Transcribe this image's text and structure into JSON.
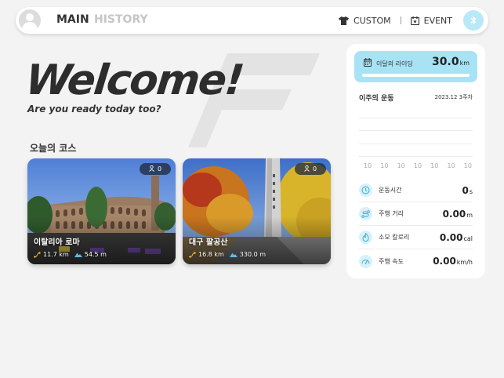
{
  "nav": {
    "main": "MAIN",
    "history": "HISTORY",
    "custom": "CUSTOM",
    "event": "EVENT"
  },
  "hero": {
    "title": "Welcome!",
    "subtitle": "Are you ready today too?"
  },
  "courses": {
    "heading": "오늘의 코스",
    "items": [
      {
        "name": "이탈리아 로마",
        "participants": "0",
        "distance": "11.7 km",
        "elevation": "54.5 m"
      },
      {
        "name": "대구 팔공산",
        "participants": "0",
        "distance": "16.8 km",
        "elevation": "330.0 m"
      }
    ]
  },
  "panel": {
    "monthly_label": "이달의 라이딩",
    "monthly_value": "30.0",
    "monthly_unit": "km",
    "week_title": "이주의 운동",
    "week_date": "2023.12 3주차",
    "week_values": [
      "10",
      "10",
      "10",
      "10",
      "10",
      "10",
      "10"
    ],
    "stats": [
      {
        "label": "운동시간",
        "value": "0",
        "unit": "s",
        "icon": "clock-icon"
      },
      {
        "label": "주행 거리",
        "value": "0.00",
        "unit": "m",
        "icon": "route-icon"
      },
      {
        "label": "소모 칼로리",
        "value": "0.00",
        "unit": "cal",
        "icon": "flame-icon"
      },
      {
        "label": "주행 속도",
        "value": "0.00",
        "unit": "km/h",
        "icon": "speedometer-icon"
      }
    ]
  },
  "colors": {
    "accent": "#a8e3f5",
    "accent_dark": "#3aa9d6"
  }
}
